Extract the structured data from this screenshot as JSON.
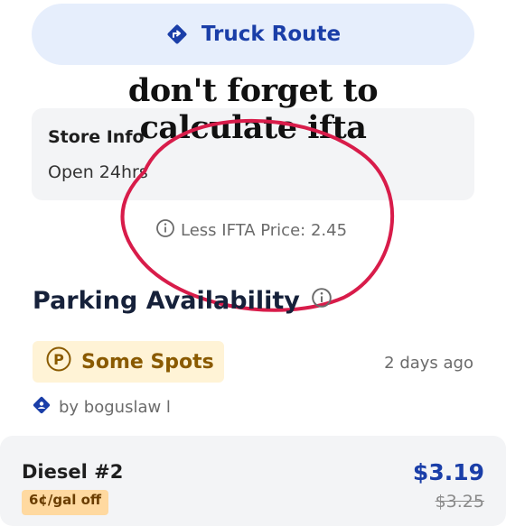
{
  "truck_route": {
    "label": "Truck Route"
  },
  "store_info": {
    "title": "Store Info",
    "hours": "Open 24hrs"
  },
  "caption": {
    "line1": "don't forget to",
    "line2": "calculate ifta"
  },
  "ifta": {
    "text": "Less IFTA Price: 2.45"
  },
  "parking": {
    "title": "Parking Availability",
    "status": "Some Spots",
    "updated": "2 days ago",
    "user": "by boguslaw l"
  },
  "fuel": {
    "name": "Diesel #2",
    "price": "$3.19",
    "discount": "6¢/gal off",
    "original_price": "$3.25"
  },
  "colors": {
    "brand_blue": "#1a3ea8",
    "button_bg": "#e6eefc",
    "annotation_red": "#d81c4a",
    "badge_bg": "#fff3d6",
    "badge_text": "#8a5a00"
  }
}
